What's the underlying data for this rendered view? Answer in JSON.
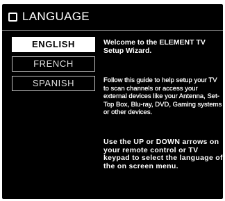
{
  "header": {
    "title": "LANGUAGE",
    "icon": "checkbox-icon"
  },
  "languages": [
    {
      "label": "ENGLISH",
      "selected": true
    },
    {
      "label": "FRENCH",
      "selected": false
    },
    {
      "label": "SPANISH",
      "selected": false
    }
  ],
  "info": {
    "welcome": "Welcome to the ELEMENT TV Setup Wizard.",
    "guide": "Follow this guide to help setup your TV to scan channels or access your external devices like your Antenna, Set-Top Box, Blu-ray, DVD, Gaming systems or other  devices.",
    "instructions": "Use the UP or DOWN arrows on your remote control or TV keypad to select the language of the on screen menu."
  },
  "colors": {
    "background": "#000000",
    "text": "#ffffff",
    "selected_background": "#ffffff",
    "selected_text": "#000000"
  }
}
